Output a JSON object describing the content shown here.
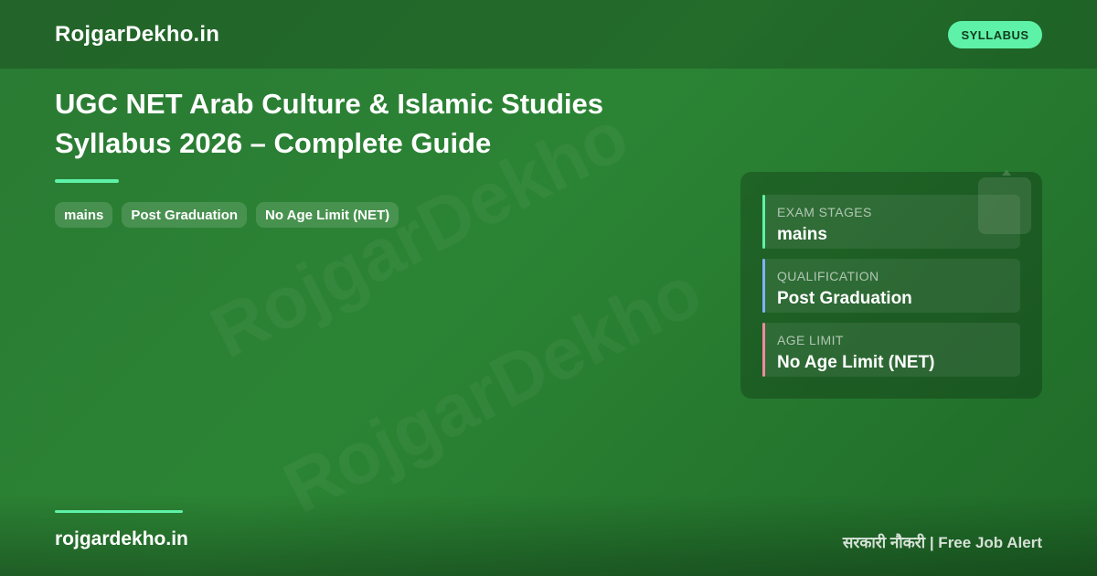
{
  "header": {
    "brand": "RojgarDekho.in",
    "badge": "SYLLABUS"
  },
  "watermark": "RojgarDekho",
  "main": {
    "title_line1": "UGC NET Arab Culture & Islamic Studies",
    "title_line2": "Syllabus 2026 – Complete Guide",
    "tags": [
      "mains",
      "Post Graduation",
      "No Age Limit (NET)"
    ]
  },
  "panel": {
    "cards": [
      {
        "label": "EXAM STAGES",
        "value": "mains",
        "color": "#5ef2a8"
      },
      {
        "label": "QUALIFICATION",
        "value": "Post Graduation",
        "color": "#7fb2ff"
      },
      {
        "label": "AGE LIMIT",
        "value": "No Age Limit (NET)",
        "color": "#f48aa0"
      }
    ]
  },
  "footer": {
    "site": "rojgardekho.in",
    "tagline": "सरकारी नौकरी | Free Job Alert"
  },
  "colors": {
    "accent": "#5ef2a8",
    "background": "#2b8434"
  }
}
